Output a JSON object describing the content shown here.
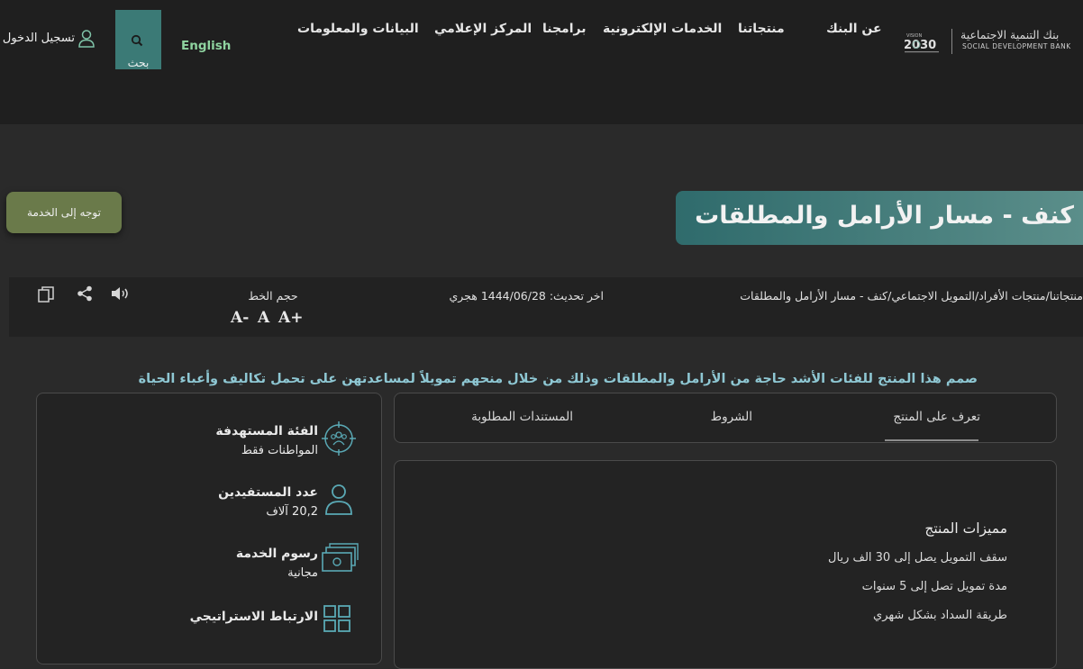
{
  "header": {
    "logo_ar": "بنك التنمية الاجتماعية",
    "logo_en": "SOCIAL DEVELOPMENT BANK",
    "vision": "VISION 2030",
    "nav": [
      "عن البنك",
      "منتجاتنا",
      "الخدمات الإلكترونية",
      "برامجنا",
      "المركز الإعلامي",
      "البيانات والمعلومات"
    ],
    "language": "English",
    "search_label": "بحث",
    "login_label": "تسجيل الدخول"
  },
  "page": {
    "title": "كنف - مسار الأرامل والمطلقات",
    "cta_label": "توجه إلى الخدمة"
  },
  "infobar": {
    "breadcrumb": "منتجاتنا/منتجات الأفراد/التمويل الاجتماعي/كنف - مسار الأرامل والمطلقات",
    "updated": "اخر تحديث: 1444/06/28 هجري",
    "font_size_label": "حجم الخط",
    "font_decrease": "A-",
    "font_normal": "A",
    "font_increase": "A+"
  },
  "description": "صمم هذا المنتج للفئات الأشد حاجة من الأرامل والمطلقات وذلك من خلال منحهم تمويلاً لمساعدتهن على تحمل تكاليف وأعباء الحياة",
  "stats": [
    {
      "title": "الفئة المستهدفة",
      "value": "المواطنات فقط",
      "icon": "target-group-icon"
    },
    {
      "title": "عدد المستفيدين",
      "value": "20,2 آلاف",
      "icon": "user-icon"
    },
    {
      "title": "رسوم الخدمة",
      "value": "مجانية",
      "icon": "money-icon"
    },
    {
      "title": "الارتباط الاستراتيجي",
      "value": "",
      "icon": "grid-icon"
    }
  ],
  "tabs": [
    "تعرف على المنتج",
    "الشروط",
    "المستندات المطلوبة"
  ],
  "content": {
    "features_title": "مميزات المنتج",
    "features": [
      "سقف التمويل يصل إلى 30 الف ريال",
      "مدة تمويل تصل إلى 5 سنوات",
      "طريقة السداد بشكل شهري"
    ]
  },
  "colors": {
    "accent": "#3b7a76",
    "cta": "#6a7a4a",
    "desc": "#8ec7d3",
    "english": "#8fd4a0"
  }
}
